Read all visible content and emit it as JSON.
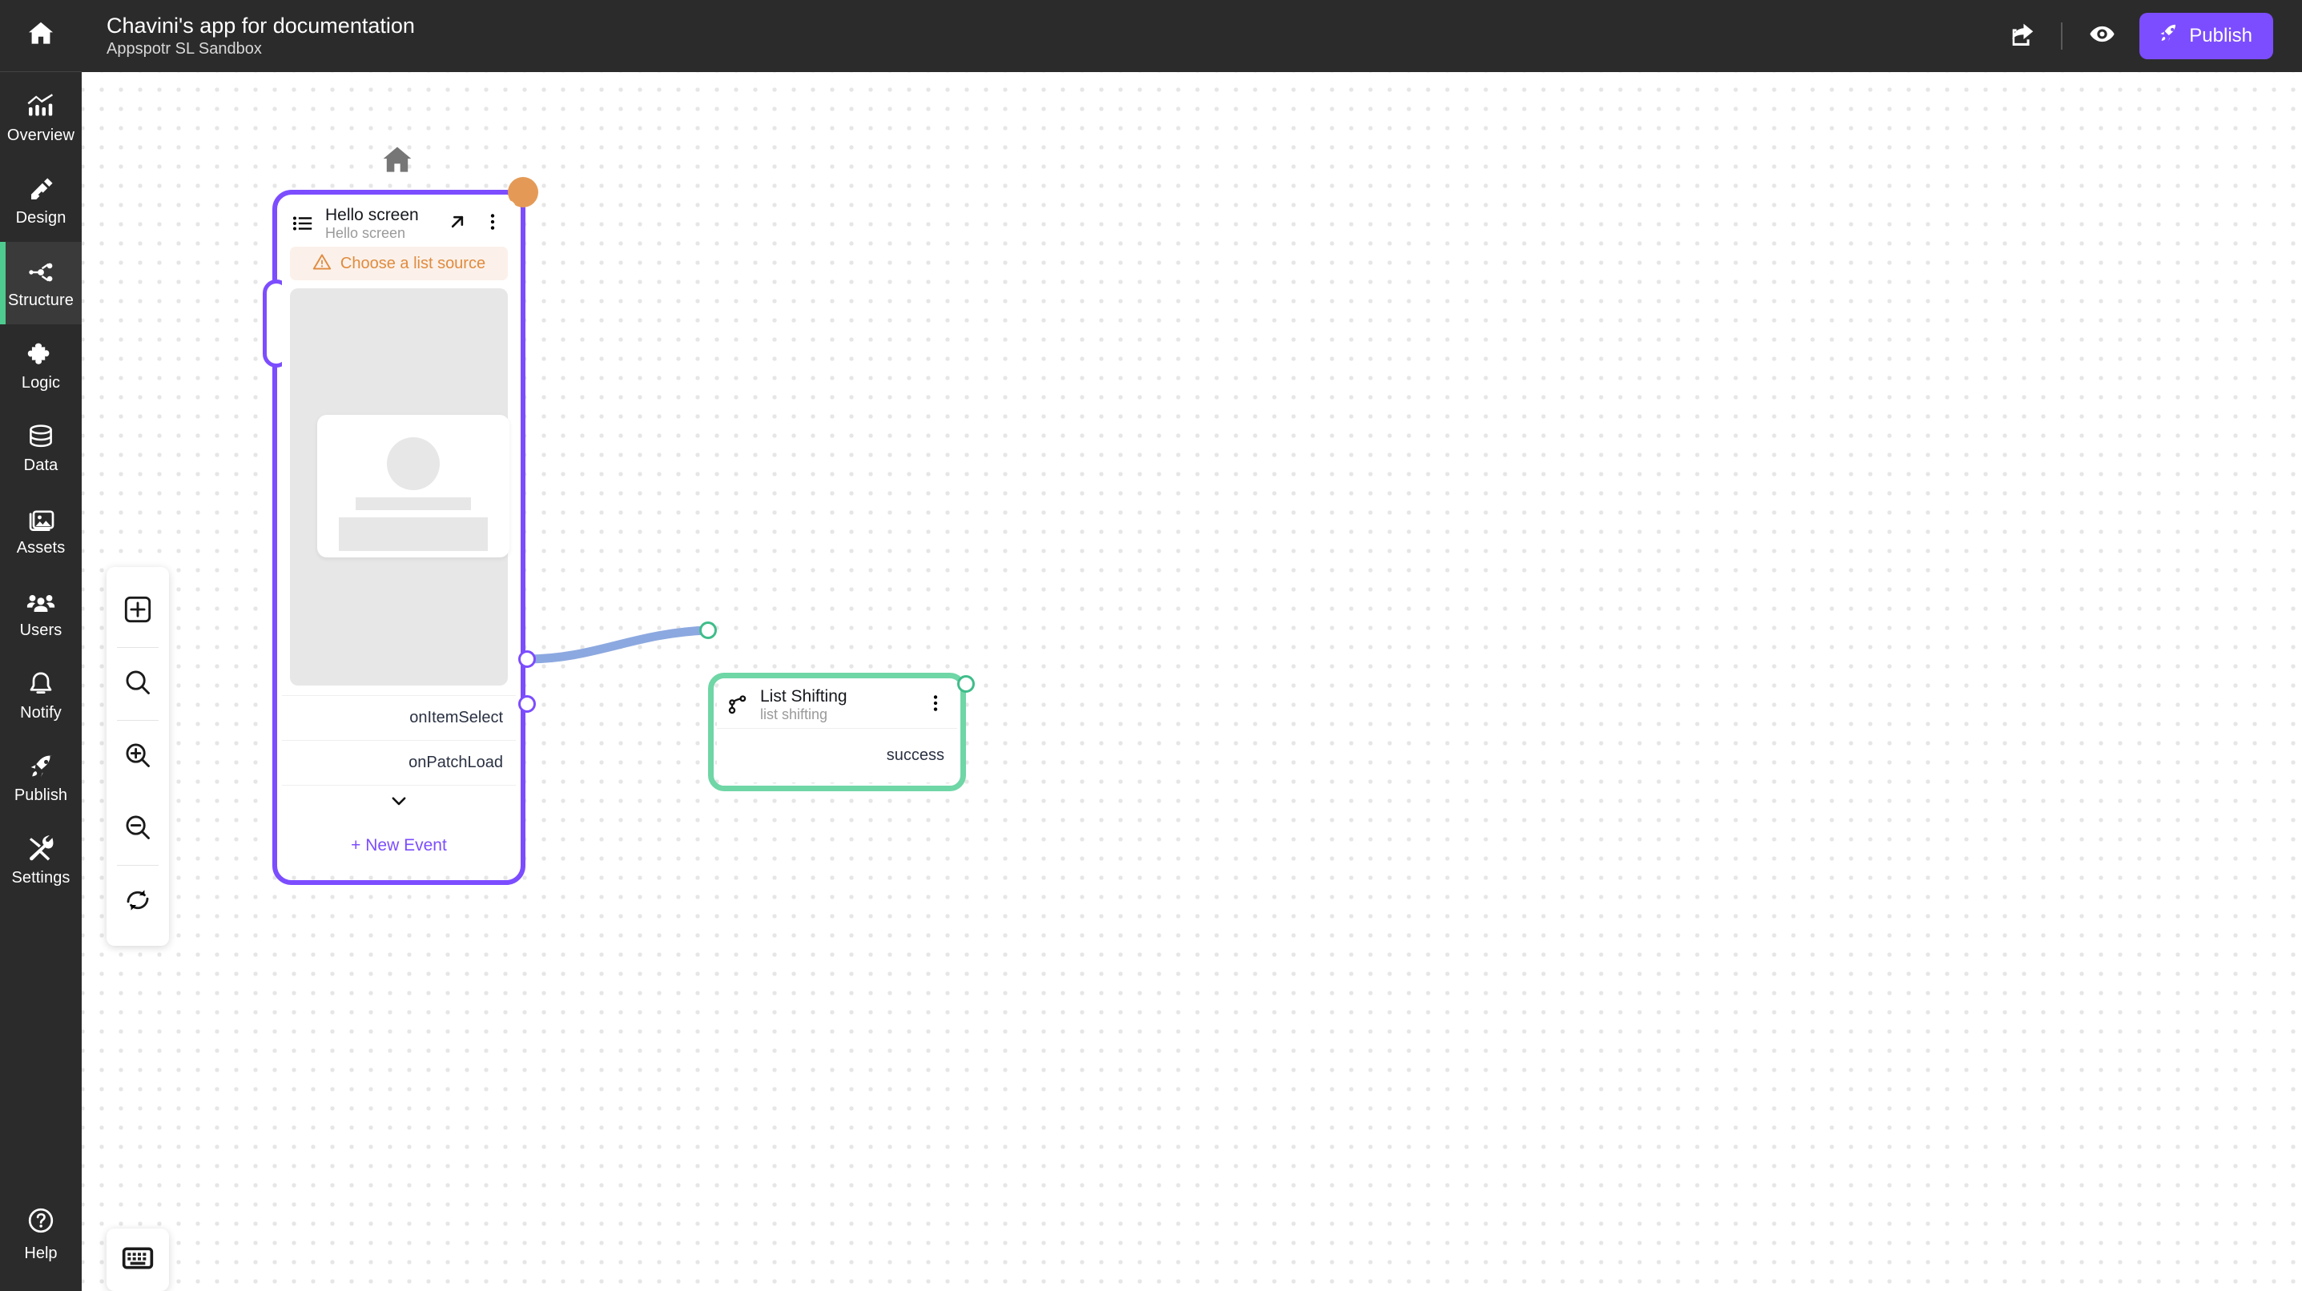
{
  "app": {
    "title": "Chavini's app for documentation",
    "subtitle": "Appspotr SL Sandbox"
  },
  "colors": {
    "rail_bg": "#2b2b2b",
    "rail_active_bg": "#3a3a3a",
    "accent_green": "#4ecb8e",
    "accent_purple": "#7c4dff",
    "node_selected_purple": "#7c4dff",
    "node_selected_green": "#6fd6a6",
    "badge_orange": "#e49a56",
    "warning_text": "#e08b3e",
    "warning_bg": "#fbf1ea",
    "edge": "#8ca8e0",
    "canvas_dot": "#e6e6e6"
  },
  "rail": {
    "home": {
      "label": "Home",
      "icon": "home-icon"
    },
    "items": [
      {
        "label": "Overview",
        "icon": "overview-chart-icon",
        "active": false
      },
      {
        "label": "Design",
        "icon": "design-pencil-icon",
        "active": false
      },
      {
        "label": "Structure",
        "icon": "structure-nodes-icon",
        "active": true
      },
      {
        "label": "Logic",
        "icon": "logic-puzzle-icon",
        "active": false
      },
      {
        "label": "Data",
        "icon": "data-database-icon",
        "active": false
      },
      {
        "label": "Assets",
        "icon": "assets-image-icon",
        "active": false
      },
      {
        "label": "Users",
        "icon": "users-group-icon",
        "active": false
      },
      {
        "label": "Notify",
        "icon": "notify-bell-icon",
        "active": false
      },
      {
        "label": "Publish",
        "icon": "publish-rocket-icon",
        "active": false
      },
      {
        "label": "Settings",
        "icon": "settings-tools-icon",
        "active": false
      }
    ],
    "help": {
      "label": "Help",
      "icon": "help-question-icon"
    }
  },
  "topbar": {
    "share": {
      "name": "share-icon",
      "tooltip": "Share"
    },
    "preview": {
      "name": "eye-icon",
      "tooltip": "Preview"
    },
    "publish_button": {
      "label": "Publish",
      "icon": "rocket-icon"
    }
  },
  "toolbar": {
    "buttons": [
      {
        "name": "add-node-button",
        "icon": "plus-square-icon"
      },
      {
        "name": "search-button",
        "icon": "search-icon"
      },
      {
        "name": "zoom-in-button",
        "icon": "zoom-in-icon"
      },
      {
        "name": "zoom-out-button",
        "icon": "zoom-out-icon"
      },
      {
        "name": "reset-view-button",
        "icon": "refresh-icon"
      }
    ],
    "keyboard_shortcuts": {
      "name": "keyboard-shortcuts-button",
      "icon": "keyboard-icon"
    }
  },
  "canvas": {
    "home_marker": {
      "icon": "home-icon"
    },
    "screen_node": {
      "title": "Hello screen",
      "subtitle": "Hello screen",
      "icon": "list-icon",
      "open_icon": "open-arrow-icon",
      "menu_icon": "kebab-menu-icon",
      "warning": {
        "text": "Choose a list source",
        "icon": "warning-triangle-icon"
      },
      "events": [
        {
          "label": "onItemSelect",
          "connected": true
        },
        {
          "label": "onPatchLoad",
          "connected": false
        }
      ],
      "expand_icon": "chevron-down-icon",
      "new_event_label": "+ New Event",
      "selected": true,
      "badge": "start-screen-badge"
    },
    "logic_node": {
      "title": "List Shifting",
      "subtitle": "list shifting",
      "icon": "branch-icon",
      "menu_icon": "kebab-menu-icon",
      "output": "success",
      "selected": true
    },
    "connection": {
      "from": "onItemSelect",
      "to": "List Shifting"
    }
  }
}
